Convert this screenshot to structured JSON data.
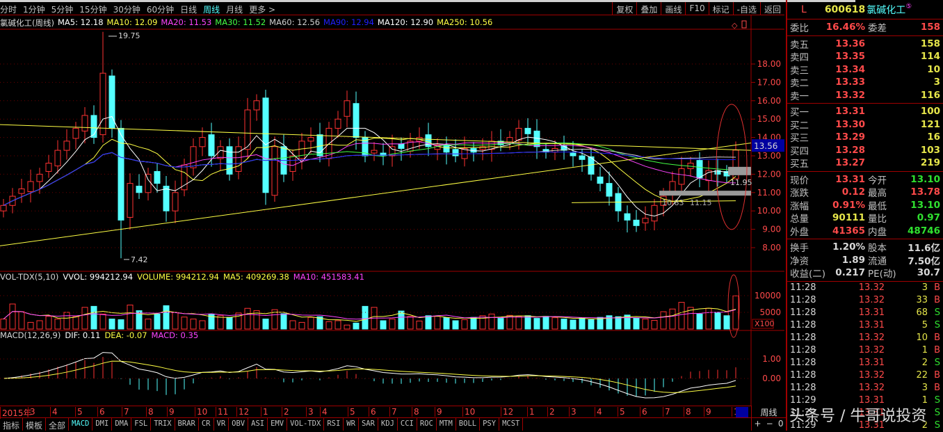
{
  "toolbar": {
    "periods": [
      "分时",
      "1分钟",
      "5分钟",
      "15分钟",
      "30分钟",
      "60分钟",
      "日线",
      "周线",
      "月线",
      "更多 >"
    ],
    "active_period": "周线",
    "buttons": [
      "复权",
      "叠加",
      "画线",
      "F10",
      "标记",
      "-自选",
      "返回"
    ]
  },
  "ma_legend": [
    {
      "text": "氯碱化工(周线)",
      "color": "#d8d8d8"
    },
    {
      "text": "MA5: 12.18",
      "color": "#ffffff"
    },
    {
      "text": "MA10: 12.09",
      "color": "#ffff44"
    },
    {
      "text": "MA20: 11.53",
      "color": "#ff44ff"
    },
    {
      "text": "MA30: 11.52",
      "color": "#44ff44"
    },
    {
      "text": "MA60: 12.56",
      "color": "#d0d0d0"
    },
    {
      "text": "MA90: 12.94",
      "color": "#2020ff"
    },
    {
      "text": "MA120: 12.90",
      "color": "#ffffff"
    },
    {
      "text": "MA250: 10.56",
      "color": "#ffff44"
    }
  ],
  "chart_data": {
    "type": "candlestick",
    "closes": [
      10.3,
      10.8,
      11.2,
      11.6,
      12.0,
      12.6,
      13.3,
      13.8,
      14.5,
      15.2,
      14.0,
      17.5,
      14.5,
      9.5,
      11.5,
      11.0,
      12.0,
      11.5,
      10.0,
      11.0,
      12.5,
      13.5,
      14.0,
      13.0,
      13.5,
      12.0,
      13.5,
      15.5,
      16.0,
      11.0,
      13.5,
      12.0,
      13.0,
      13.8,
      14.0,
      13.0,
      14.5,
      15.0,
      16.0,
      14.0,
      13.0,
      13.3,
      13.0,
      13.5,
      13.4,
      13.8,
      14.0,
      13.5,
      13.6,
      13.2,
      13.0,
      13.4,
      13.2,
      13.5,
      13.8,
      13.6,
      14.0,
      14.5,
      14.2,
      13.5,
      13.2,
      13.4,
      13.3,
      13.0,
      12.8,
      12.0,
      11.5,
      10.8,
      10.0,
      9.5,
      9.2,
      9.6,
      10.3,
      10.8,
      11.6,
      12.3,
      12.6,
      11.8,
      12.2,
      12.0,
      11.9,
      13.31
    ],
    "volumes": [
      3000,
      7500,
      5200,
      2000,
      2500,
      3800,
      3000,
      5000,
      3700,
      6500,
      6800,
      4500,
      3000,
      2800,
      7200,
      5500,
      3000,
      4500,
      7000,
      5000,
      3600,
      3000,
      2500,
      4500,
      4000,
      3500,
      4800,
      6200,
      5500,
      3000,
      5800,
      4600,
      2500,
      2000,
      3500,
      3700,
      2200,
      2500,
      1200,
      1800,
      6800,
      6500,
      2500,
      3000,
      5400,
      3800,
      2400,
      4000,
      3800,
      3400,
      2500,
      2800,
      3500,
      4000,
      4500,
      3200,
      4100,
      3800,
      4000,
      3200,
      3800,
      3400,
      3000,
      2700,
      3300,
      2800,
      3500,
      4000,
      3700,
      4200,
      3300,
      3000,
      2600,
      5200,
      6000,
      8000,
      6500,
      4500,
      6200,
      5000,
      4000,
      9942
    ],
    "price_axis": [
      "18.00",
      "17.00",
      "16.00",
      "15.00",
      "14.00",
      "13.00",
      "12.00",
      "11.00",
      "10.00",
      "9.00",
      "8.00"
    ],
    "volume_axis": [
      "10000",
      "5000",
      "X100"
    ],
    "macd_axis": [
      "1.00",
      "0.00"
    ],
    "high_label": "19.75",
    "low_label": "7.42",
    "current_price_tag": "13.56",
    "annotations": [
      "10.83",
      "11.15",
      "11.95"
    ]
  },
  "vol_header": [
    {
      "text": "VOL-TDX(5,10)",
      "color": "#d8d8d8"
    },
    {
      "text": "VVOL: 994212.94",
      "color": "#ffffff"
    },
    {
      "text": "VOLUME: 994212.94",
      "color": "#ffff44"
    },
    {
      "text": "MA5: 409269.38",
      "color": "#ffff44"
    },
    {
      "text": "MA10: 451583.41",
      "color": "#ff44ff"
    }
  ],
  "macd_header": [
    {
      "text": "MACD(12,26,9)",
      "color": "#d8d8d8"
    },
    {
      "text": "DIF: 0.11",
      "color": "#ffffff"
    },
    {
      "text": "DEA: -0.07",
      "color": "#ffff44"
    },
    {
      "text": "MACD: 0.35",
      "color": "#ff44ff"
    }
  ],
  "date_axis": [
    "2015年",
    "3",
    "4",
    "5",
    "6",
    "7",
    "8",
    "9",
    "10",
    "11",
    "12",
    "1",
    "2",
    "3",
    "4",
    "5",
    "6",
    "7",
    "8",
    "9",
    "10",
    "12",
    "1",
    "2",
    "3",
    "4",
    "5",
    "6",
    "7",
    "8",
    "9",
    "1"
  ],
  "period_label": "周线",
  "zoom_buttons": [
    "+",
    "−",
    "0"
  ],
  "indicator_tabs": [
    "指标",
    "模板",
    "全部",
    "MACD",
    "DMI",
    "DMA",
    "FSL",
    "TRIX",
    "BRAR",
    "CR",
    "VR",
    "OBV",
    "ASI",
    "EMV",
    "VOL-TDX",
    "RSI",
    "WR",
    "SAR",
    "KDJ",
    "CCI",
    "ROC",
    "MTM",
    "BOLL",
    "PSY",
    "MCST"
  ],
  "active_tab": "MACD",
  "stock": {
    "flag": "L",
    "code": "600618",
    "name": "氯碱化工",
    "badge": "⑤"
  },
  "weibi": {
    "label": "委比",
    "value": "16.46%",
    "label2": "委差",
    "value2": "158"
  },
  "sells": [
    {
      "label": "卖五",
      "price": "13.36",
      "vol": "158"
    },
    {
      "label": "卖四",
      "price": "13.35",
      "vol": "114"
    },
    {
      "label": "卖三",
      "price": "13.34",
      "vol": "10"
    },
    {
      "label": "卖二",
      "price": "13.33",
      "vol": "3"
    },
    {
      "label": "卖一",
      "price": "13.32",
      "vol": "116"
    }
  ],
  "buys": [
    {
      "label": "买一",
      "price": "13.31",
      "vol": "100"
    },
    {
      "label": "买二",
      "price": "13.30",
      "vol": "121"
    },
    {
      "label": "买三",
      "price": "13.29",
      "vol": "16"
    },
    {
      "label": "买四",
      "price": "13.28",
      "vol": "103"
    },
    {
      "label": "买五",
      "price": "13.27",
      "vol": "219"
    }
  ],
  "quote": [
    {
      "l": "现价",
      "v": "13.31",
      "vc": "red",
      "l2": "今开",
      "v2": "13.10",
      "v2c": "grn"
    },
    {
      "l": "涨跌",
      "v": "0.12",
      "vc": "red",
      "l2": "最高",
      "v2": "13.78",
      "v2c": "red"
    },
    {
      "l": "涨幅",
      "v": "0.91%",
      "vc": "red",
      "l2": "最低",
      "v2": "13.10",
      "v2c": "grn"
    },
    {
      "l": "总量",
      "v": "90111",
      "vc": "yel",
      "l2": "量比",
      "v2": "0.97",
      "v2c": "grn"
    },
    {
      "l": "外盘",
      "v": "41365",
      "vc": "red",
      "l2": "内盘",
      "v2": "48746",
      "v2c": "grn"
    }
  ],
  "fundamentals": [
    {
      "l": "换手",
      "v": "1.20%",
      "l2": "股本",
      "v2": "11.6亿"
    },
    {
      "l": "净资",
      "v": "1.89",
      "l2": "流通",
      "v2": "7.50亿"
    },
    {
      "l": "收益(二)",
      "v": "0.217",
      "l2": "PE(动)",
      "v2": "30.7"
    }
  ],
  "ticks": [
    {
      "t": "11:28",
      "p": "13.32",
      "q": "3",
      "d": "B"
    },
    {
      "t": "11:28",
      "p": "13.32",
      "q": "33",
      "d": "B"
    },
    {
      "t": "11:28",
      "p": "13.31",
      "q": "68",
      "d": "S"
    },
    {
      "t": "11:28",
      "p": "13.31",
      "q": "5",
      "d": "S"
    },
    {
      "t": "11:28",
      "p": "13.32",
      "q": "10",
      "d": "B"
    },
    {
      "t": "11:28",
      "p": "13.32",
      "q": "1",
      "d": "B"
    },
    {
      "t": "11:28",
      "p": "13.31",
      "q": "2",
      "d": "S"
    },
    {
      "t": "11:28",
      "p": "13.32",
      "q": "22",
      "d": "B"
    },
    {
      "t": "11:28",
      "p": "13.32",
      "q": "3",
      "d": "B"
    },
    {
      "t": "11:29",
      "p": "13.31",
      "q": "1",
      "d": "S"
    },
    {
      "t": "11:29",
      "p": "13.31",
      "q": "",
      "d": "S"
    },
    {
      "t": "11:29",
      "p": "13.31",
      "q": "2",
      "d": "S"
    }
  ],
  "watermark": "头条号 / 牛哥说投资",
  "colors": {
    "up": "#ff3232",
    "down": "#54ffff",
    "grid": "#a00000"
  }
}
